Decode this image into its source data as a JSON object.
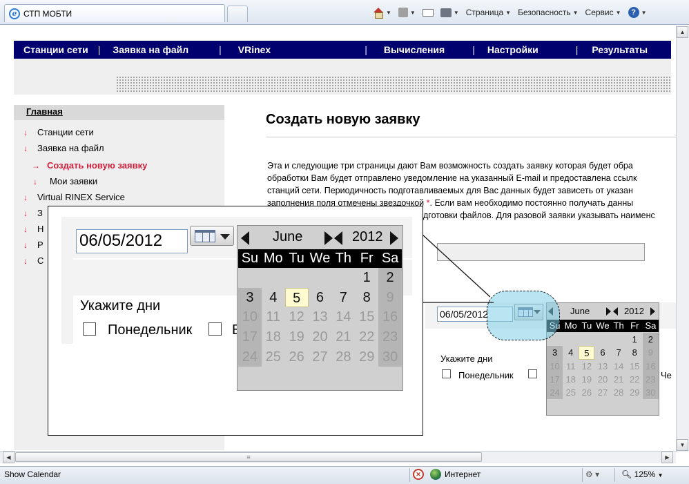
{
  "browser": {
    "tab_title": "СТП МОБТИ",
    "menu": {
      "page": "Страница",
      "security": "Безопасность",
      "tools": "Сервис"
    }
  },
  "nav": {
    "items": [
      "Станции сети",
      "Заявка на файл",
      "VRinex",
      "Вычисления",
      "Настройки",
      "Результаты"
    ],
    "separator": "|"
  },
  "sidebar": {
    "home": "Главная",
    "items": [
      {
        "label": "Станции сети",
        "level": 0,
        "active": false
      },
      {
        "label": "Заявка на файл",
        "level": 0,
        "active": false
      },
      {
        "label": "Создать новую заявку",
        "level": 1,
        "active": true
      },
      {
        "label": "Мои заявки",
        "level": 1,
        "active": false
      },
      {
        "label": "Virtual RINEX Service",
        "level": 0,
        "active": false
      },
      {
        "label": "З",
        "level": 0,
        "active": false
      },
      {
        "label": "Н",
        "level": 0,
        "active": false
      },
      {
        "label": "Р",
        "level": 0,
        "active": false
      },
      {
        "label": "С",
        "level": 0,
        "active": false
      }
    ]
  },
  "main": {
    "title": "Создать новую заявку",
    "paragraph": [
      "Эта и следующие три страницы дают Вам возможность создать заявку которая будет обра",
      "обработки Вам будет отправлено уведомление на указанный E-mail и предоставлена ссылк",
      "станций сети. Периодичность подготавливаемых для Вас данных будет зависеть от указан",
      "заполнения поля отмечены звездочкой",
      "дготовки файлов. Для разовой заявки указывать наименс"
    ],
    "paragraph_line4_star": "*",
    "paragraph_line4_tail": ". Если вам необходимо постоянно получать данны"
  },
  "form": {
    "date_value": "06/05/2012",
    "days_label": "Укажите дни",
    "monday": "Понедельник",
    "tuesday_fragment": "В",
    "thursday_fragment": "Че"
  },
  "calendar": {
    "month": "June",
    "year": "2012",
    "weekdays": [
      "Su",
      "Mo",
      "Tu",
      "We",
      "Th",
      "Fr",
      "Sa"
    ],
    "weeks": [
      [
        "",
        "",
        "",
        "",
        "",
        "1",
        "2"
      ],
      [
        "3",
        "4",
        "5",
        "6",
        "7",
        "8",
        "9"
      ],
      [
        "10",
        "11",
        "12",
        "13",
        "14",
        "15",
        "16"
      ],
      [
        "17",
        "18",
        "19",
        "20",
        "21",
        "22",
        "23"
      ],
      [
        "24",
        "25",
        "26",
        "27",
        "28",
        "29",
        "30"
      ]
    ],
    "today": "5",
    "enabled_through": 8,
    "highlight_color": "#fffbd0"
  },
  "statusbar": {
    "text": "Show Calendar",
    "zone": "Интернет",
    "zoom": "125%"
  },
  "colors": {
    "nav_bg": "#00006e",
    "accent_red": "#d21f3c",
    "bubble": "#80cee8"
  }
}
